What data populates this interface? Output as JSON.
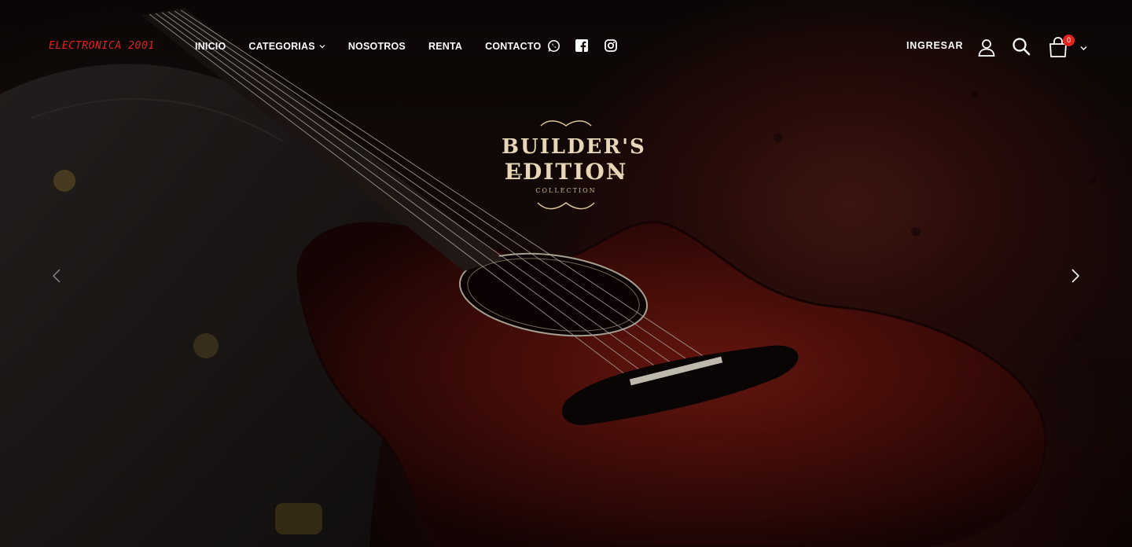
{
  "header": {
    "logo_text": "ELECTRONICA 2001",
    "nav": [
      {
        "label": "INICIO"
      },
      {
        "label": "CATEGORIAS"
      },
      {
        "label": "NOSOTROS"
      },
      {
        "label": "RENTA"
      },
      {
        "label": "CONTACTO"
      }
    ],
    "social": [
      "whatsapp-icon",
      "facebook-icon",
      "instagram-icon"
    ],
    "login_label": "INGRESAR",
    "cart_count": "0",
    "accent_color": "#e0211c"
  },
  "slider": {
    "brand": {
      "line1": "BUILDER'S",
      "line2": "EDITION",
      "line3": "COLLECTION"
    },
    "prev_icon": "chevron-left-icon",
    "next_icon": "chevron-right-icon"
  }
}
